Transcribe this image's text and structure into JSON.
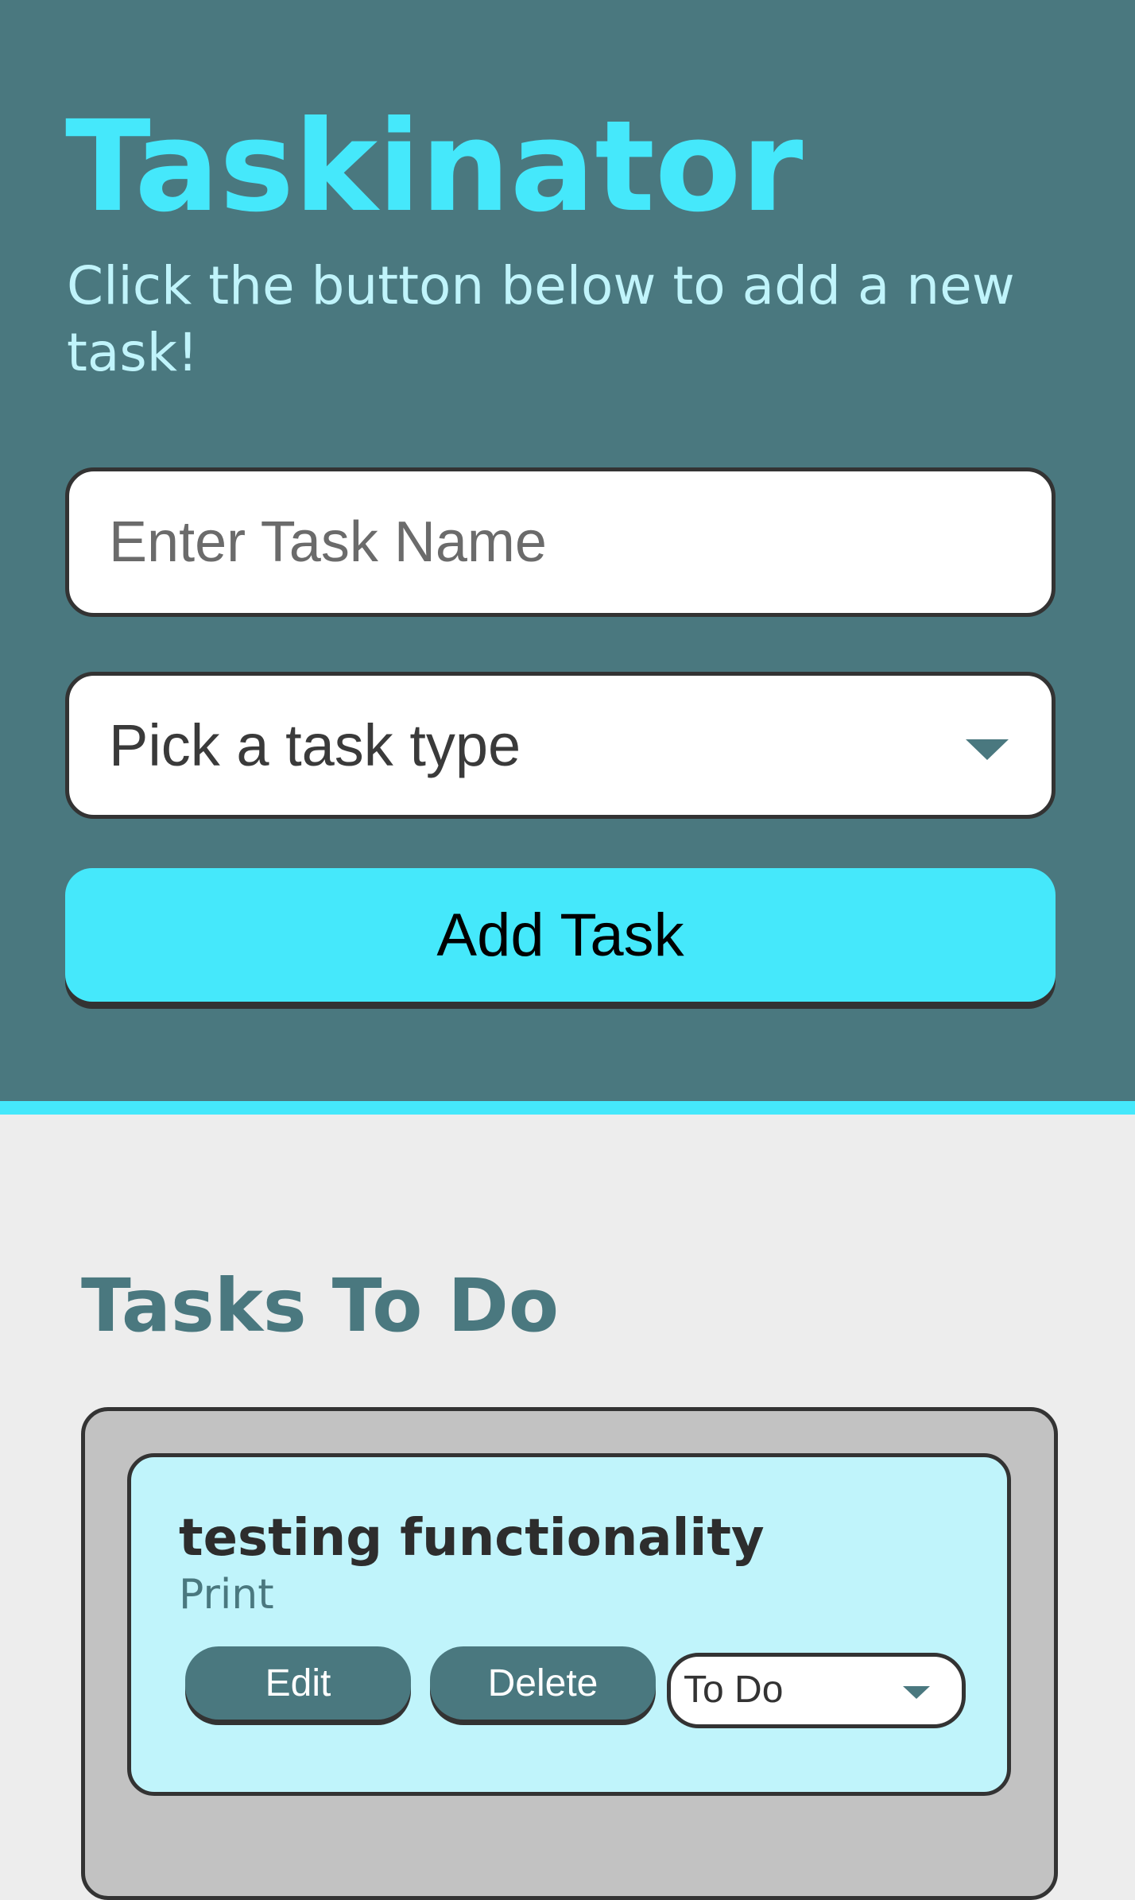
{
  "app": {
    "title": "Taskinator",
    "subtitle": "Click the button below to add a new task!"
  },
  "form": {
    "task_name_placeholder": "Enter Task Name",
    "task_name_value": "",
    "task_type_selected": "Pick a task type",
    "add_button_label": "Add Task"
  },
  "tasks_section": {
    "title": "Tasks To Do",
    "tasks": [
      {
        "name": "testing functionality",
        "type": "Print",
        "edit_label": "Edit",
        "delete_label": "Delete",
        "status_selected": "To Do"
      }
    ]
  },
  "colors": {
    "header_bg": "#4a787f",
    "accent": "#45e8fb",
    "page_bg": "#ededed",
    "task_list_bg": "#c2c2c2",
    "task_card_bg": "#c0f4fb"
  },
  "icons": {
    "task_type_dropdown": "chevron-down-icon",
    "status_dropdown": "chevron-down-icon"
  }
}
